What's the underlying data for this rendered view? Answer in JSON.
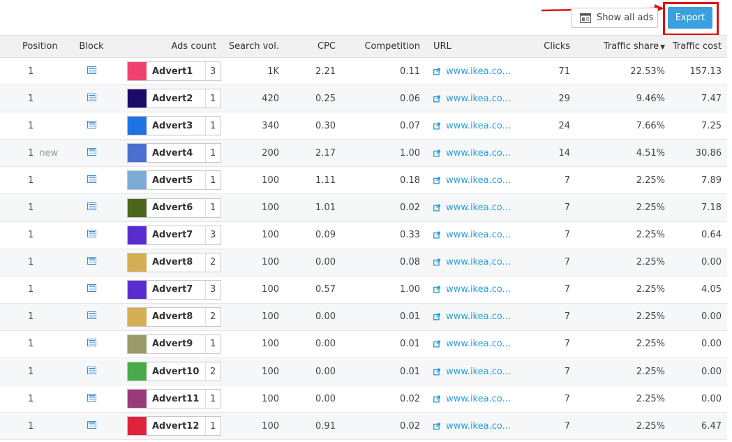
{
  "toolbar": {
    "show_all_label": "Show all ads",
    "export_label": "Export"
  },
  "table": {
    "headers": {
      "position": "Position",
      "block": "Block",
      "ads_count": "Ads count",
      "search_vol": "Search vol.",
      "cpc": "CPC",
      "competition": "Competition",
      "url": "URL",
      "clicks": "Clicks",
      "traffic_share": "Traffic share",
      "traffic_cost": "Traffic cost"
    },
    "rows": [
      {
        "position": "1",
        "new": "",
        "advert": "Advert1",
        "count": "3",
        "color": "#f0426e",
        "search_vol": "1K",
        "cpc": "2.21",
        "competition": "0.11",
        "url": "www.ikea.co...",
        "clicks": "71",
        "traffic_share": "22.53%",
        "traffic_cost": "157.13"
      },
      {
        "position": "1",
        "new": "",
        "advert": "Advert2",
        "count": "1",
        "color": "#1c0a6b",
        "search_vol": "420",
        "cpc": "0.25",
        "competition": "0.06",
        "url": "www.ikea.co...",
        "clicks": "29",
        "traffic_share": "9.46%",
        "traffic_cost": "7.47"
      },
      {
        "position": "1",
        "new": "",
        "advert": "Advert3",
        "count": "1",
        "color": "#1f72e4",
        "search_vol": "340",
        "cpc": "0.30",
        "competition": "0.07",
        "url": "www.ikea.co...",
        "clicks": "24",
        "traffic_share": "7.66%",
        "traffic_cost": "7.25"
      },
      {
        "position": "1",
        "new": "new",
        "advert": "Advert4",
        "count": "1",
        "color": "#4a6fd1",
        "search_vol": "200",
        "cpc": "2.17",
        "competition": "1.00",
        "url": "www.ikea.co...",
        "clicks": "14",
        "traffic_share": "4.51%",
        "traffic_cost": "30.86"
      },
      {
        "position": "1",
        "new": "",
        "advert": "Advert5",
        "count": "1",
        "color": "#7eaad6",
        "search_vol": "100",
        "cpc": "1.11",
        "competition": "0.18",
        "url": "www.ikea.co...",
        "clicks": "7",
        "traffic_share": "2.25%",
        "traffic_cost": "7.89"
      },
      {
        "position": "1",
        "new": "",
        "advert": "Advert6",
        "count": "1",
        "color": "#4a661a",
        "search_vol": "100",
        "cpc": "1.01",
        "competition": "0.02",
        "url": "www.ikea.co...",
        "clicks": "7",
        "traffic_share": "2.25%",
        "traffic_cost": "7.18"
      },
      {
        "position": "1",
        "new": "",
        "advert": "Advert7",
        "count": "3",
        "color": "#5a2ccf",
        "search_vol": "100",
        "cpc": "0.09",
        "competition": "0.33",
        "url": "www.ikea.co...",
        "clicks": "7",
        "traffic_share": "2.25%",
        "traffic_cost": "0.64"
      },
      {
        "position": "1",
        "new": "",
        "advert": "Advert8",
        "count": "2",
        "color": "#d4ae54",
        "search_vol": "100",
        "cpc": "0.00",
        "competition": "0.08",
        "url": "www.ikea.co...",
        "clicks": "7",
        "traffic_share": "2.25%",
        "traffic_cost": "0.00"
      },
      {
        "position": "1",
        "new": "",
        "advert": "Advert7",
        "count": "3",
        "color": "#5a2ccf",
        "search_vol": "100",
        "cpc": "0.57",
        "competition": "1.00",
        "url": "www.ikea.co...",
        "clicks": "7",
        "traffic_share": "2.25%",
        "traffic_cost": "4.05"
      },
      {
        "position": "1",
        "new": "",
        "advert": "Advert8",
        "count": "2",
        "color": "#d4ae54",
        "search_vol": "100",
        "cpc": "0.00",
        "competition": "0.01",
        "url": "www.ikea.co...",
        "clicks": "7",
        "traffic_share": "2.25%",
        "traffic_cost": "0.00"
      },
      {
        "position": "1",
        "new": "",
        "advert": "Advert9",
        "count": "1",
        "color": "#9a9b6a",
        "search_vol": "100",
        "cpc": "0.00",
        "competition": "0.01",
        "url": "www.ikea.co...",
        "clicks": "7",
        "traffic_share": "2.25%",
        "traffic_cost": "0.00"
      },
      {
        "position": "1",
        "new": "",
        "advert": "Advert10",
        "count": "2",
        "color": "#4aaa4a",
        "search_vol": "100",
        "cpc": "0.00",
        "competition": "0.01",
        "url": "www.ikea.co...",
        "clicks": "7",
        "traffic_share": "2.25%",
        "traffic_cost": "0.00"
      },
      {
        "position": "1",
        "new": "",
        "advert": "Advert11",
        "count": "1",
        "color": "#9a3a78",
        "search_vol": "100",
        "cpc": "0.00",
        "competition": "0.02",
        "url": "www.ikea.co...",
        "clicks": "7",
        "traffic_share": "2.25%",
        "traffic_cost": "0.00"
      },
      {
        "position": "1",
        "new": "",
        "advert": "Advert12",
        "count": "1",
        "color": "#e0223c",
        "search_vol": "100",
        "cpc": "0.91",
        "competition": "0.02",
        "url": "www.ikea.co...",
        "clicks": "7",
        "traffic_share": "2.25%",
        "traffic_cost": "6.47"
      }
    ]
  },
  "icons": {
    "block": "block-layout-icon",
    "url": "external-link-icon",
    "show_all": "ad-preview-icon",
    "sort": "sort-desc-icon"
  },
  "colors": {
    "accent": "#3aa0e0",
    "highlight": "#e01010",
    "link": "#2a9fd8"
  }
}
